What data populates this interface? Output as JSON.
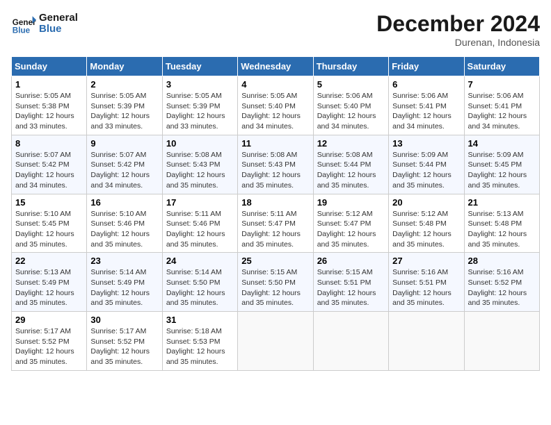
{
  "header": {
    "logo_general": "General",
    "logo_blue": "Blue",
    "month": "December 2024",
    "location": "Durenan, Indonesia"
  },
  "columns": [
    "Sunday",
    "Monday",
    "Tuesday",
    "Wednesday",
    "Thursday",
    "Friday",
    "Saturday"
  ],
  "weeks": [
    [
      {
        "day": "1",
        "sunrise": "Sunrise: 5:05 AM",
        "sunset": "Sunset: 5:38 PM",
        "daylight": "Daylight: 12 hours and 33 minutes."
      },
      {
        "day": "2",
        "sunrise": "Sunrise: 5:05 AM",
        "sunset": "Sunset: 5:39 PM",
        "daylight": "Daylight: 12 hours and 33 minutes."
      },
      {
        "day": "3",
        "sunrise": "Sunrise: 5:05 AM",
        "sunset": "Sunset: 5:39 PM",
        "daylight": "Daylight: 12 hours and 33 minutes."
      },
      {
        "day": "4",
        "sunrise": "Sunrise: 5:05 AM",
        "sunset": "Sunset: 5:40 PM",
        "daylight": "Daylight: 12 hours and 34 minutes."
      },
      {
        "day": "5",
        "sunrise": "Sunrise: 5:06 AM",
        "sunset": "Sunset: 5:40 PM",
        "daylight": "Daylight: 12 hours and 34 minutes."
      },
      {
        "day": "6",
        "sunrise": "Sunrise: 5:06 AM",
        "sunset": "Sunset: 5:41 PM",
        "daylight": "Daylight: 12 hours and 34 minutes."
      },
      {
        "day": "7",
        "sunrise": "Sunrise: 5:06 AM",
        "sunset": "Sunset: 5:41 PM",
        "daylight": "Daylight: 12 hours and 34 minutes."
      }
    ],
    [
      {
        "day": "8",
        "sunrise": "Sunrise: 5:07 AM",
        "sunset": "Sunset: 5:42 PM",
        "daylight": "Daylight: 12 hours and 34 minutes."
      },
      {
        "day": "9",
        "sunrise": "Sunrise: 5:07 AM",
        "sunset": "Sunset: 5:42 PM",
        "daylight": "Daylight: 12 hours and 34 minutes."
      },
      {
        "day": "10",
        "sunrise": "Sunrise: 5:08 AM",
        "sunset": "Sunset: 5:43 PM",
        "daylight": "Daylight: 12 hours and 35 minutes."
      },
      {
        "day": "11",
        "sunrise": "Sunrise: 5:08 AM",
        "sunset": "Sunset: 5:43 PM",
        "daylight": "Daylight: 12 hours and 35 minutes."
      },
      {
        "day": "12",
        "sunrise": "Sunrise: 5:08 AM",
        "sunset": "Sunset: 5:44 PM",
        "daylight": "Daylight: 12 hours and 35 minutes."
      },
      {
        "day": "13",
        "sunrise": "Sunrise: 5:09 AM",
        "sunset": "Sunset: 5:44 PM",
        "daylight": "Daylight: 12 hours and 35 minutes."
      },
      {
        "day": "14",
        "sunrise": "Sunrise: 5:09 AM",
        "sunset": "Sunset: 5:45 PM",
        "daylight": "Daylight: 12 hours and 35 minutes."
      }
    ],
    [
      {
        "day": "15",
        "sunrise": "Sunrise: 5:10 AM",
        "sunset": "Sunset: 5:45 PM",
        "daylight": "Daylight: 12 hours and 35 minutes."
      },
      {
        "day": "16",
        "sunrise": "Sunrise: 5:10 AM",
        "sunset": "Sunset: 5:46 PM",
        "daylight": "Daylight: 12 hours and 35 minutes."
      },
      {
        "day": "17",
        "sunrise": "Sunrise: 5:11 AM",
        "sunset": "Sunset: 5:46 PM",
        "daylight": "Daylight: 12 hours and 35 minutes."
      },
      {
        "day": "18",
        "sunrise": "Sunrise: 5:11 AM",
        "sunset": "Sunset: 5:47 PM",
        "daylight": "Daylight: 12 hours and 35 minutes."
      },
      {
        "day": "19",
        "sunrise": "Sunrise: 5:12 AM",
        "sunset": "Sunset: 5:47 PM",
        "daylight": "Daylight: 12 hours and 35 minutes."
      },
      {
        "day": "20",
        "sunrise": "Sunrise: 5:12 AM",
        "sunset": "Sunset: 5:48 PM",
        "daylight": "Daylight: 12 hours and 35 minutes."
      },
      {
        "day": "21",
        "sunrise": "Sunrise: 5:13 AM",
        "sunset": "Sunset: 5:48 PM",
        "daylight": "Daylight: 12 hours and 35 minutes."
      }
    ],
    [
      {
        "day": "22",
        "sunrise": "Sunrise: 5:13 AM",
        "sunset": "Sunset: 5:49 PM",
        "daylight": "Daylight: 12 hours and 35 minutes."
      },
      {
        "day": "23",
        "sunrise": "Sunrise: 5:14 AM",
        "sunset": "Sunset: 5:49 PM",
        "daylight": "Daylight: 12 hours and 35 minutes."
      },
      {
        "day": "24",
        "sunrise": "Sunrise: 5:14 AM",
        "sunset": "Sunset: 5:50 PM",
        "daylight": "Daylight: 12 hours and 35 minutes."
      },
      {
        "day": "25",
        "sunrise": "Sunrise: 5:15 AM",
        "sunset": "Sunset: 5:50 PM",
        "daylight": "Daylight: 12 hours and 35 minutes."
      },
      {
        "day": "26",
        "sunrise": "Sunrise: 5:15 AM",
        "sunset": "Sunset: 5:51 PM",
        "daylight": "Daylight: 12 hours and 35 minutes."
      },
      {
        "day": "27",
        "sunrise": "Sunrise: 5:16 AM",
        "sunset": "Sunset: 5:51 PM",
        "daylight": "Daylight: 12 hours and 35 minutes."
      },
      {
        "day": "28",
        "sunrise": "Sunrise: 5:16 AM",
        "sunset": "Sunset: 5:52 PM",
        "daylight": "Daylight: 12 hours and 35 minutes."
      }
    ],
    [
      {
        "day": "29",
        "sunrise": "Sunrise: 5:17 AM",
        "sunset": "Sunset: 5:52 PM",
        "daylight": "Daylight: 12 hours and 35 minutes."
      },
      {
        "day": "30",
        "sunrise": "Sunrise: 5:17 AM",
        "sunset": "Sunset: 5:52 PM",
        "daylight": "Daylight: 12 hours and 35 minutes."
      },
      {
        "day": "31",
        "sunrise": "Sunrise: 5:18 AM",
        "sunset": "Sunset: 5:53 PM",
        "daylight": "Daylight: 12 hours and 35 minutes."
      },
      null,
      null,
      null,
      null
    ]
  ]
}
